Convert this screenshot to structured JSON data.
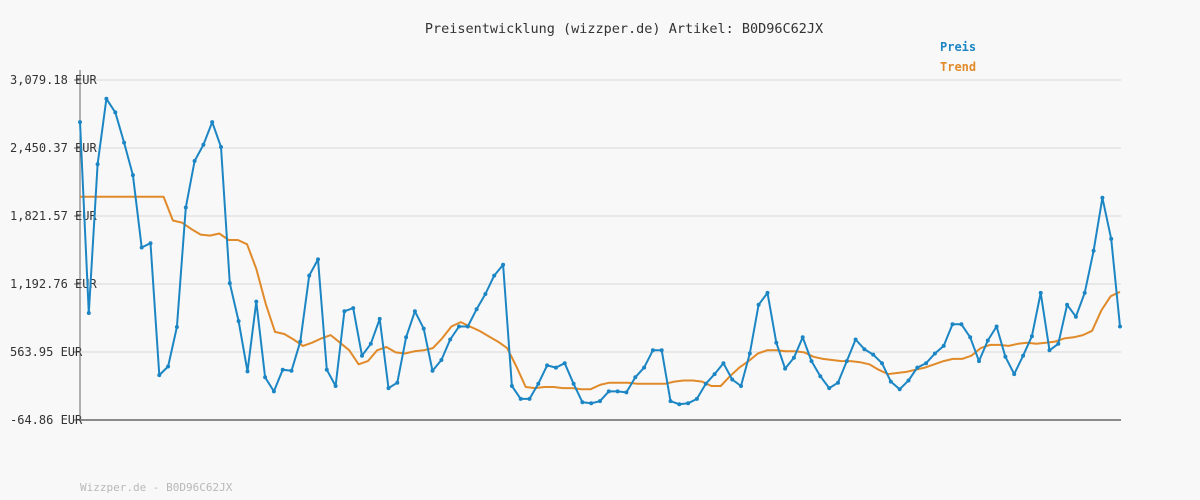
{
  "colors": {
    "background": "#f8f8f8",
    "grid": "#e2e2e2",
    "axis": "#666666",
    "price": "#1c86c4",
    "trend": "#e08a2a",
    "footer": "#b8b8b8"
  },
  "chart_data": {
    "type": "line",
    "title": "Preisentwicklung (wizzper.de) Artikel: B0D96C62JX",
    "xlabel": "",
    "ylabel": "",
    "ylim": [
      -64.86,
      3079.18
    ],
    "y_ticks": [
      -64.86,
      563.95,
      1192.76,
      1821.57,
      2450.37,
      3079.18
    ],
    "y_tick_labels": [
      "-64.86 EUR",
      "563.95 EUR",
      "1,192.76 EUR",
      "1,821.57 EUR",
      "2,450.37 EUR",
      "3,079.18 EUR"
    ],
    "grid": true,
    "legend_position": "top-right",
    "series": [
      {
        "name": "Preis",
        "color": "#1c86c4",
        "markers": true,
        "values": [
          2690,
          925,
          2300,
          2905,
          2780,
          2500,
          2200,
          1530,
          1570,
          350,
          430,
          795,
          1900,
          2330,
          2480,
          2690,
          2460,
          1200,
          850,
          385,
          1030,
          330,
          200,
          400,
          390,
          660,
          1270,
          1420,
          400,
          250,
          940,
          970,
          530,
          640,
          870,
          230,
          280,
          700,
          940,
          780,
          390,
          490,
          680,
          800,
          800,
          960,
          1100,
          1270,
          1370,
          250,
          130,
          130,
          270,
          440,
          420,
          460,
          270,
          100,
          90,
          110,
          200,
          200,
          190,
          330,
          420,
          580,
          580,
          110,
          80,
          90,
          130,
          270,
          360,
          460,
          310,
          250,
          550,
          1000,
          1110,
          650,
          410,
          510,
          700,
          480,
          340,
          230,
          280,
          480,
          680,
          590,
          540,
          460,
          290,
          220,
          300,
          420,
          460,
          550,
          620,
          820,
          820,
          700,
          480,
          670,
          800,
          520,
          360,
          530,
          710,
          1110,
          580,
          640,
          1000,
          890,
          1110,
          1500,
          1990,
          1610,
          800
        ]
      },
      {
        "name": "Trend",
        "color": "#e08a2a",
        "markers": false,
        "values": [
          2000,
          2000,
          2000,
          2000,
          2000,
          2000,
          2000,
          2000,
          2000,
          2000,
          1780,
          1760,
          1700,
          1650,
          1640,
          1660,
          1600,
          1600,
          1560,
          1330,
          1010,
          750,
          730,
          680,
          620,
          650,
          690,
          720,
          650,
          580,
          450,
          480,
          580,
          610,
          560,
          550,
          570,
          580,
          600,
          690,
          800,
          840,
          800,
          760,
          710,
          660,
          600,
          430,
          240,
          230,
          240,
          240,
          230,
          230,
          220,
          220,
          260,
          280,
          280,
          280,
          270,
          270,
          270,
          270,
          290,
          300,
          300,
          290,
          250,
          250,
          340,
          420,
          480,
          550,
          580,
          580,
          570,
          570,
          560,
          520,
          500,
          490,
          480,
          480,
          470,
          450,
          400,
          360,
          370,
          380,
          400,
          420,
          450,
          480,
          500,
          500,
          530,
          600,
          630,
          630,
          620,
          640,
          650,
          640,
          650,
          660,
          690,
          700,
          720,
          760,
          950,
          1080,
          1120
        ]
      }
    ]
  },
  "legend": {
    "price_label": "Preis",
    "trend_label": "Trend"
  },
  "footer": {
    "text": "Wizzper.de - B0D96C62JX"
  }
}
